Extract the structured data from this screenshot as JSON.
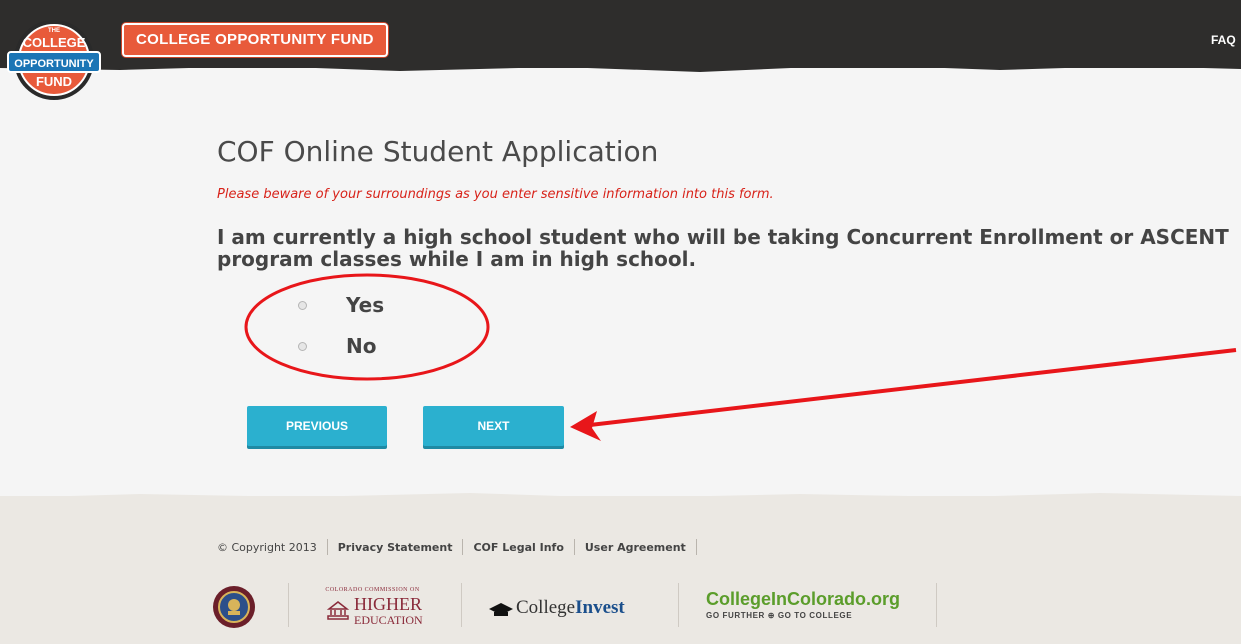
{
  "header": {
    "logo_text": [
      "THE",
      "COLLEGE",
      "OPPORTUNITY",
      "FUND"
    ],
    "brand_label": "COLLEGE OPPORTUNITY FUND",
    "nav_faq": "FAQ"
  },
  "main": {
    "title": "COF Online Student Application",
    "warning": "Please beware of your surroundings as you enter sensitive information into this form.",
    "question": "I am currently a high school student who will be taking Concurrent Enrollment or ASCENT program classes while I am in high school.",
    "options": [
      {
        "label": "Yes",
        "selected": false
      },
      {
        "label": "No",
        "selected": false
      }
    ],
    "buttons": {
      "previous": "PREVIOUS",
      "next": "NEXT"
    }
  },
  "footer": {
    "copyright": "© Copyright 2013",
    "links": [
      "Privacy Statement",
      "COF Legal Info",
      "User Agreement"
    ],
    "partners": {
      "cche_line1": "COLORADO COMMISSION ON",
      "cche_line2": "HIGHER",
      "cche_line3": "EDUCATION",
      "college_invest_a": "College",
      "college_invest_b": "Invest",
      "cic_main": "CollegeInColorado.org",
      "cic_tag": "GO FURTHER ⊕ GO TO COLLEGE"
    }
  },
  "colors": {
    "header_bg": "#2e2d2c",
    "brand_orange": "#e85a3a",
    "button_blue": "#2bb0cf",
    "warning_red": "#d8231a",
    "annotation_red": "#e8161a"
  }
}
